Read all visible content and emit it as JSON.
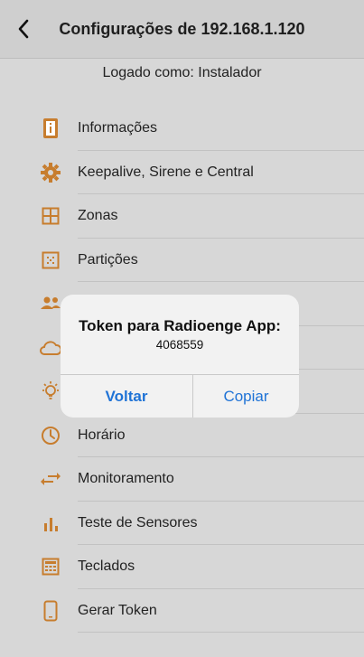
{
  "colors": {
    "accent": "#c77d2e",
    "link": "#1f73d6"
  },
  "navbar": {
    "title": "Configurações de 192.168.1.120",
    "back_icon": "chevron-left-icon"
  },
  "logged_as": "Logado como: Instalador",
  "menu": [
    {
      "label": "Informações",
      "icon": "info-icon"
    },
    {
      "label": "Keepalive, Sirene e Central",
      "icon": "gear-icon"
    },
    {
      "label": "Zonas",
      "icon": "grid-icon"
    },
    {
      "label": "Partições",
      "icon": "partition-icon"
    },
    {
      "label": "",
      "icon": "users-icon"
    },
    {
      "label": "",
      "icon": "cloud-icon"
    },
    {
      "label": "",
      "icon": "lightbulb-icon"
    },
    {
      "label": "Horário",
      "icon": "clock-icon"
    },
    {
      "label": "Monitoramento",
      "icon": "arrows-icon"
    },
    {
      "label": "Teste de Sensores",
      "icon": "bars-icon"
    },
    {
      "label": "Teclados",
      "icon": "keypad-icon"
    },
    {
      "label": "Gerar Token",
      "icon": "phone-icon"
    }
  ],
  "alert": {
    "title": "Token para Radioenge App:",
    "message": "4068559",
    "cancel_label": "Voltar",
    "confirm_label": "Copiar"
  }
}
